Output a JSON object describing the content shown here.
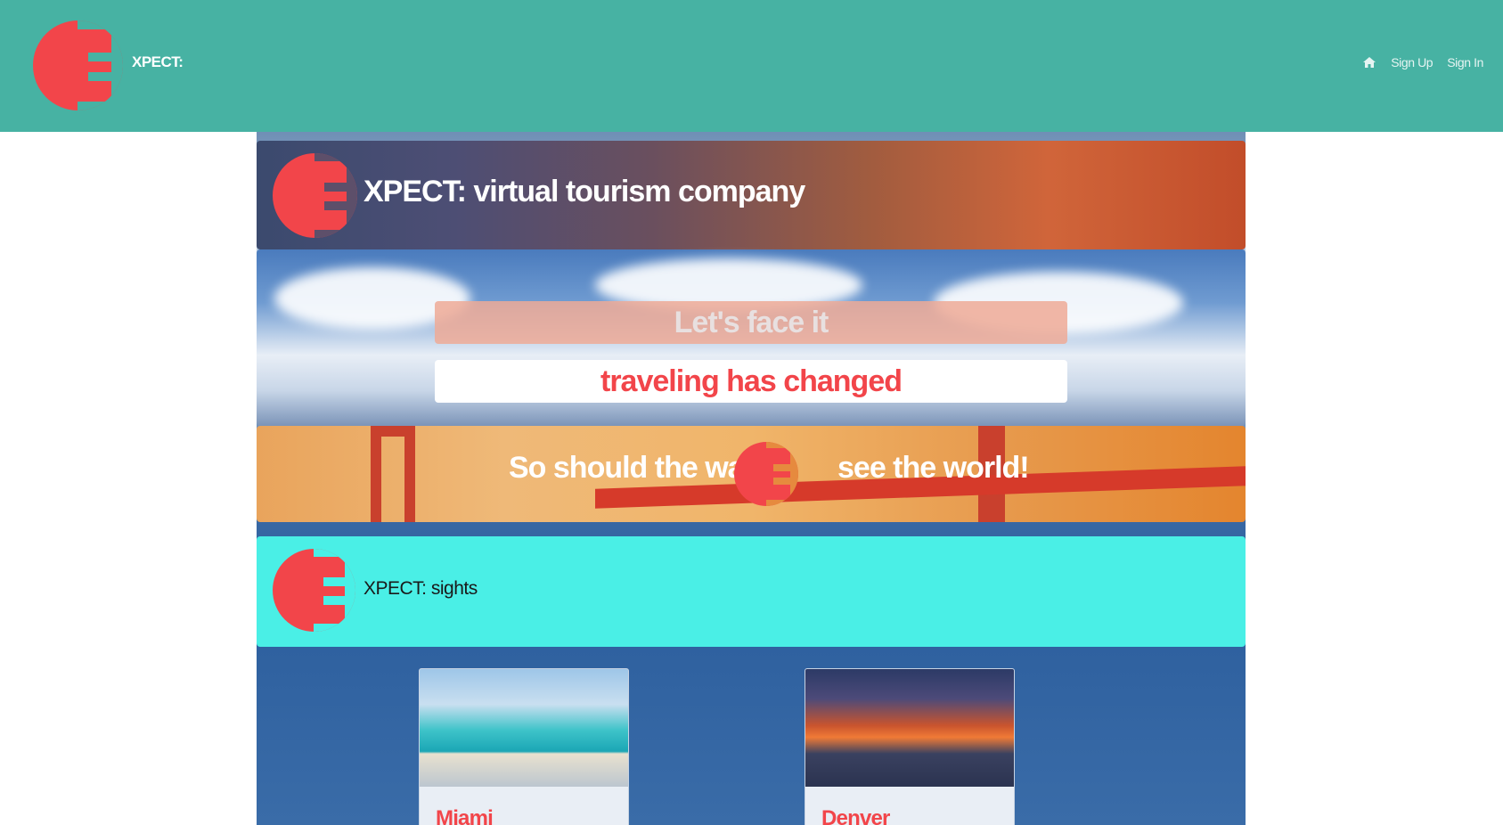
{
  "navbar": {
    "brand": "XPECT:",
    "links": [
      {
        "label": "Sign Up"
      },
      {
        "label": "Sign In"
      }
    ],
    "home_icon": "home-icon"
  },
  "hero": {
    "title": "XPECT: virtual tourism company",
    "line1": "Let's face it",
    "line2": "traveling has changed",
    "line3_left": "So should the way w",
    "line3_right": "see the world!"
  },
  "sights": {
    "title": "XPECT: sights",
    "cards": [
      {
        "title": "Miami"
      },
      {
        "title": "Denver"
      }
    ]
  },
  "colors": {
    "navbar": "#47b2a3",
    "logo": "#f2454a",
    "sights_banner": "#4aefe6"
  }
}
